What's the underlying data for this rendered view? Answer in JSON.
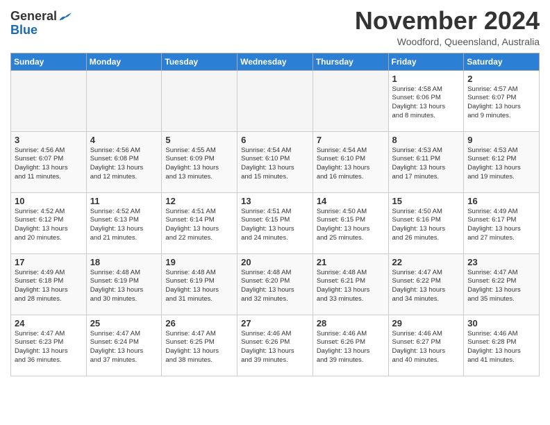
{
  "header": {
    "logo_general": "General",
    "logo_blue": "Blue",
    "month": "November 2024",
    "location": "Woodford, Queensland, Australia"
  },
  "days_of_week": [
    "Sunday",
    "Monday",
    "Tuesday",
    "Wednesday",
    "Thursday",
    "Friday",
    "Saturday"
  ],
  "weeks": [
    [
      {
        "day": "",
        "detail": ""
      },
      {
        "day": "",
        "detail": ""
      },
      {
        "day": "",
        "detail": ""
      },
      {
        "day": "",
        "detail": ""
      },
      {
        "day": "",
        "detail": ""
      },
      {
        "day": "1",
        "detail": "Sunrise: 4:58 AM\nSunset: 6:06 PM\nDaylight: 13 hours\nand 8 minutes."
      },
      {
        "day": "2",
        "detail": "Sunrise: 4:57 AM\nSunset: 6:07 PM\nDaylight: 13 hours\nand 9 minutes."
      }
    ],
    [
      {
        "day": "3",
        "detail": "Sunrise: 4:56 AM\nSunset: 6:07 PM\nDaylight: 13 hours\nand 11 minutes."
      },
      {
        "day": "4",
        "detail": "Sunrise: 4:56 AM\nSunset: 6:08 PM\nDaylight: 13 hours\nand 12 minutes."
      },
      {
        "day": "5",
        "detail": "Sunrise: 4:55 AM\nSunset: 6:09 PM\nDaylight: 13 hours\nand 13 minutes."
      },
      {
        "day": "6",
        "detail": "Sunrise: 4:54 AM\nSunset: 6:10 PM\nDaylight: 13 hours\nand 15 minutes."
      },
      {
        "day": "7",
        "detail": "Sunrise: 4:54 AM\nSunset: 6:10 PM\nDaylight: 13 hours\nand 16 minutes."
      },
      {
        "day": "8",
        "detail": "Sunrise: 4:53 AM\nSunset: 6:11 PM\nDaylight: 13 hours\nand 17 minutes."
      },
      {
        "day": "9",
        "detail": "Sunrise: 4:53 AM\nSunset: 6:12 PM\nDaylight: 13 hours\nand 19 minutes."
      }
    ],
    [
      {
        "day": "10",
        "detail": "Sunrise: 4:52 AM\nSunset: 6:12 PM\nDaylight: 13 hours\nand 20 minutes."
      },
      {
        "day": "11",
        "detail": "Sunrise: 4:52 AM\nSunset: 6:13 PM\nDaylight: 13 hours\nand 21 minutes."
      },
      {
        "day": "12",
        "detail": "Sunrise: 4:51 AM\nSunset: 6:14 PM\nDaylight: 13 hours\nand 22 minutes."
      },
      {
        "day": "13",
        "detail": "Sunrise: 4:51 AM\nSunset: 6:15 PM\nDaylight: 13 hours\nand 24 minutes."
      },
      {
        "day": "14",
        "detail": "Sunrise: 4:50 AM\nSunset: 6:15 PM\nDaylight: 13 hours\nand 25 minutes."
      },
      {
        "day": "15",
        "detail": "Sunrise: 4:50 AM\nSunset: 6:16 PM\nDaylight: 13 hours\nand 26 minutes."
      },
      {
        "day": "16",
        "detail": "Sunrise: 4:49 AM\nSunset: 6:17 PM\nDaylight: 13 hours\nand 27 minutes."
      }
    ],
    [
      {
        "day": "17",
        "detail": "Sunrise: 4:49 AM\nSunset: 6:18 PM\nDaylight: 13 hours\nand 28 minutes."
      },
      {
        "day": "18",
        "detail": "Sunrise: 4:48 AM\nSunset: 6:19 PM\nDaylight: 13 hours\nand 30 minutes."
      },
      {
        "day": "19",
        "detail": "Sunrise: 4:48 AM\nSunset: 6:19 PM\nDaylight: 13 hours\nand 31 minutes."
      },
      {
        "day": "20",
        "detail": "Sunrise: 4:48 AM\nSunset: 6:20 PM\nDaylight: 13 hours\nand 32 minutes."
      },
      {
        "day": "21",
        "detail": "Sunrise: 4:48 AM\nSunset: 6:21 PM\nDaylight: 13 hours\nand 33 minutes."
      },
      {
        "day": "22",
        "detail": "Sunrise: 4:47 AM\nSunset: 6:22 PM\nDaylight: 13 hours\nand 34 minutes."
      },
      {
        "day": "23",
        "detail": "Sunrise: 4:47 AM\nSunset: 6:22 PM\nDaylight: 13 hours\nand 35 minutes."
      }
    ],
    [
      {
        "day": "24",
        "detail": "Sunrise: 4:47 AM\nSunset: 6:23 PM\nDaylight: 13 hours\nand 36 minutes."
      },
      {
        "day": "25",
        "detail": "Sunrise: 4:47 AM\nSunset: 6:24 PM\nDaylight: 13 hours\nand 37 minutes."
      },
      {
        "day": "26",
        "detail": "Sunrise: 4:47 AM\nSunset: 6:25 PM\nDaylight: 13 hours\nand 38 minutes."
      },
      {
        "day": "27",
        "detail": "Sunrise: 4:46 AM\nSunset: 6:26 PM\nDaylight: 13 hours\nand 39 minutes."
      },
      {
        "day": "28",
        "detail": "Sunrise: 4:46 AM\nSunset: 6:26 PM\nDaylight: 13 hours\nand 39 minutes."
      },
      {
        "day": "29",
        "detail": "Sunrise: 4:46 AM\nSunset: 6:27 PM\nDaylight: 13 hours\nand 40 minutes."
      },
      {
        "day": "30",
        "detail": "Sunrise: 4:46 AM\nSunset: 6:28 PM\nDaylight: 13 hours\nand 41 minutes."
      }
    ]
  ]
}
